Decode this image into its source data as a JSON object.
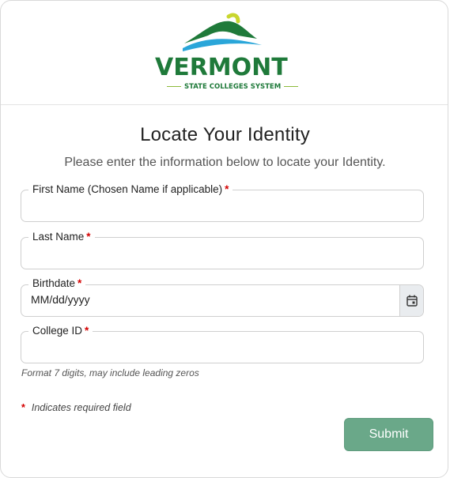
{
  "logo": {
    "word": "VERMONT",
    "subtitle": "STATE COLLEGES SYSTEM"
  },
  "page": {
    "title": "Locate Your Identity",
    "subtitle": "Please enter the information below to locate your Identity."
  },
  "form": {
    "first_name_label": "First Name (Chosen Name if applicable)",
    "last_name_label": "Last Name",
    "birthdate_label": "Birthdate",
    "birthdate_value": "MM/dd/yyyy",
    "college_id_label": "College ID",
    "college_id_hint": "Format 7 digits, may include leading zeros",
    "required_marker": "*",
    "required_note": "Indicates required field",
    "submit_label": "Submit"
  },
  "icons": {
    "calendar": "calendar-icon"
  },
  "colors": {
    "brand_green": "#1f7a3a",
    "accent_lime": "#8dbb3c",
    "accent_blue": "#2aa6d9",
    "submit_bg": "#6aa889",
    "required": "#d40000"
  }
}
